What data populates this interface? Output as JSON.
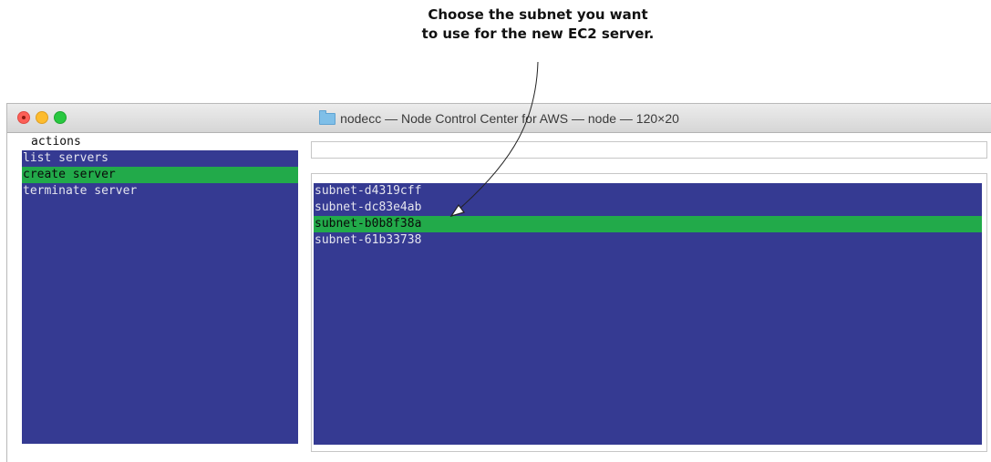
{
  "annotation": {
    "line1": "Choose the subnet you want",
    "line2": "to use for the new EC2 server."
  },
  "window": {
    "title": "nodecc — Node Control Center for AWS — node — 120×20",
    "title_icon": "folder-icon",
    "traffic_lights": [
      "close",
      "minimize",
      "zoom"
    ]
  },
  "actions": {
    "label": "actions",
    "selected_index": 1,
    "items": [
      {
        "label": "list servers"
      },
      {
        "label": "create server"
      },
      {
        "label": "terminate server"
      }
    ]
  },
  "search": {
    "value": ""
  },
  "subnets": {
    "selected_index": 2,
    "items": [
      {
        "label": "subnet-d4319cff"
      },
      {
        "label": "subnet-dc83e4ab"
      },
      {
        "label": "subnet-b0b8f38a"
      },
      {
        "label": "subnet-61b33738"
      }
    ]
  },
  "colors": {
    "list_background": "#353a92",
    "selection": "#22aa4a",
    "list_text": "#e4e4ee"
  }
}
